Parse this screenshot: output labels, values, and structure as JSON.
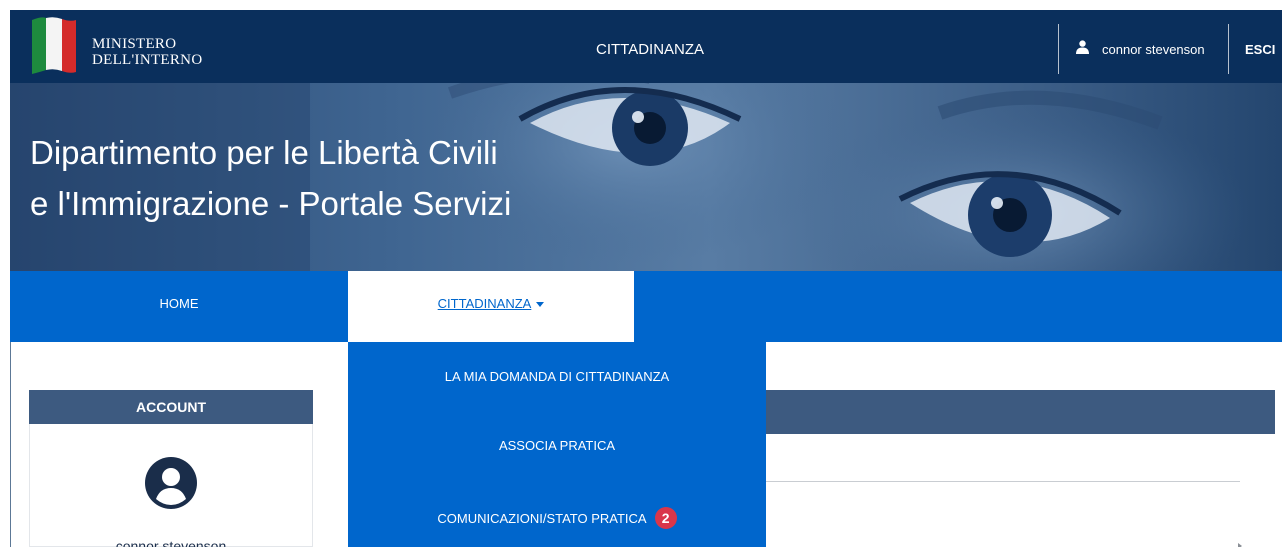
{
  "header": {
    "logo_line1": "MINISTERO",
    "logo_line2": "DELL'INTERNO",
    "title": "CITTADINANZA",
    "user_name": "connor stevenson",
    "logout_label": "ESCI"
  },
  "hero": {
    "title_line1": "Dipartimento per le Libertà Civili",
    "title_line2": "e l'Immigrazione - Portale Servizi"
  },
  "nav": {
    "home_label": "HOME",
    "cittadinanza_label": "CITTADINANZA"
  },
  "dropdown": {
    "items": [
      {
        "label": "LA MIA DOMANDA DI CITTADINANZA"
      },
      {
        "label": "ASSOCIA PRATICA"
      },
      {
        "label": "COMUNICAZIONI/STATO PRATICA",
        "badge": "2"
      }
    ]
  },
  "account": {
    "heading": "ACCOUNT",
    "name": "connor stevenson"
  },
  "icons": {
    "flag": "italian-flag-icon",
    "user": "user-icon",
    "avatar": "user-circle-icon",
    "caret": "caret-down-icon"
  },
  "colors": {
    "header_bg": "#0a2f5c",
    "nav_bg": "#0066cc",
    "card_header_bg": "#3d5a80",
    "badge_bg": "#d9364a"
  }
}
